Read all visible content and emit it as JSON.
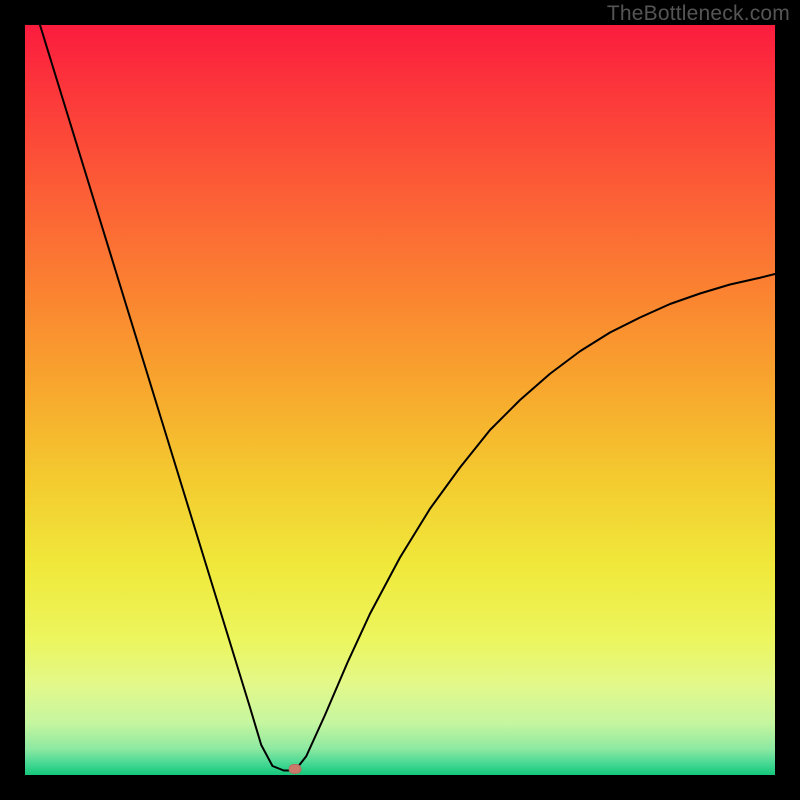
{
  "watermark": "TheBottleneck.com",
  "chart_data": {
    "type": "line",
    "title": "",
    "xlabel": "",
    "ylabel": "",
    "xlim": [
      0,
      100
    ],
    "ylim": [
      0,
      100
    ],
    "curve_color": "#000000",
    "curve_stroke_width": 2,
    "curve_points": [
      {
        "x": 2.0,
        "y": 100.0
      },
      {
        "x": 4.0,
        "y": 93.5
      },
      {
        "x": 6.0,
        "y": 87.0
      },
      {
        "x": 8.0,
        "y": 80.5
      },
      {
        "x": 10.0,
        "y": 74.0
      },
      {
        "x": 12.0,
        "y": 67.5
      },
      {
        "x": 14.0,
        "y": 61.0
      },
      {
        "x": 16.0,
        "y": 54.5
      },
      {
        "x": 18.0,
        "y": 48.0
      },
      {
        "x": 20.0,
        "y": 41.5
      },
      {
        "x": 22.0,
        "y": 35.0
      },
      {
        "x": 24.0,
        "y": 28.5
      },
      {
        "x": 26.0,
        "y": 22.0
      },
      {
        "x": 28.0,
        "y": 15.5
      },
      {
        "x": 30.0,
        "y": 9.0
      },
      {
        "x": 31.5,
        "y": 4.0
      },
      {
        "x": 33.0,
        "y": 1.2
      },
      {
        "x": 34.5,
        "y": 0.6
      },
      {
        "x": 36.0,
        "y": 0.6
      },
      {
        "x": 37.5,
        "y": 2.5
      },
      {
        "x": 40.0,
        "y": 8.0
      },
      {
        "x": 43.0,
        "y": 15.0
      },
      {
        "x": 46.0,
        "y": 21.5
      },
      {
        "x": 50.0,
        "y": 29.0
      },
      {
        "x": 54.0,
        "y": 35.5
      },
      {
        "x": 58.0,
        "y": 41.0
      },
      {
        "x": 62.0,
        "y": 46.0
      },
      {
        "x": 66.0,
        "y": 50.0
      },
      {
        "x": 70.0,
        "y": 53.5
      },
      {
        "x": 74.0,
        "y": 56.5
      },
      {
        "x": 78.0,
        "y": 59.0
      },
      {
        "x": 82.0,
        "y": 61.0
      },
      {
        "x": 86.0,
        "y": 62.8
      },
      {
        "x": 90.0,
        "y": 64.2
      },
      {
        "x": 94.0,
        "y": 65.4
      },
      {
        "x": 98.0,
        "y": 66.3
      },
      {
        "x": 100.0,
        "y": 66.8
      }
    ],
    "marker": {
      "x": 36.0,
      "y": 0.8,
      "color": "#c97a6a"
    },
    "background_gradient": {
      "stops": [
        {
          "offset": 0.0,
          "color": "#fb1c3e"
        },
        {
          "offset": 0.1,
          "color": "#fc3a3a"
        },
        {
          "offset": 0.22,
          "color": "#fc5d36"
        },
        {
          "offset": 0.35,
          "color": "#fb8131"
        },
        {
          "offset": 0.48,
          "color": "#f8a62e"
        },
        {
          "offset": 0.6,
          "color": "#f4c92f"
        },
        {
          "offset": 0.72,
          "color": "#f0e83a"
        },
        {
          "offset": 0.82,
          "color": "#ecf65e"
        },
        {
          "offset": 0.88,
          "color": "#e2f88a"
        },
        {
          "offset": 0.93,
          "color": "#c6f6a0"
        },
        {
          "offset": 0.965,
          "color": "#8ee9a1"
        },
        {
          "offset": 0.985,
          "color": "#45d893"
        },
        {
          "offset": 1.0,
          "color": "#14c77a"
        }
      ]
    }
  }
}
